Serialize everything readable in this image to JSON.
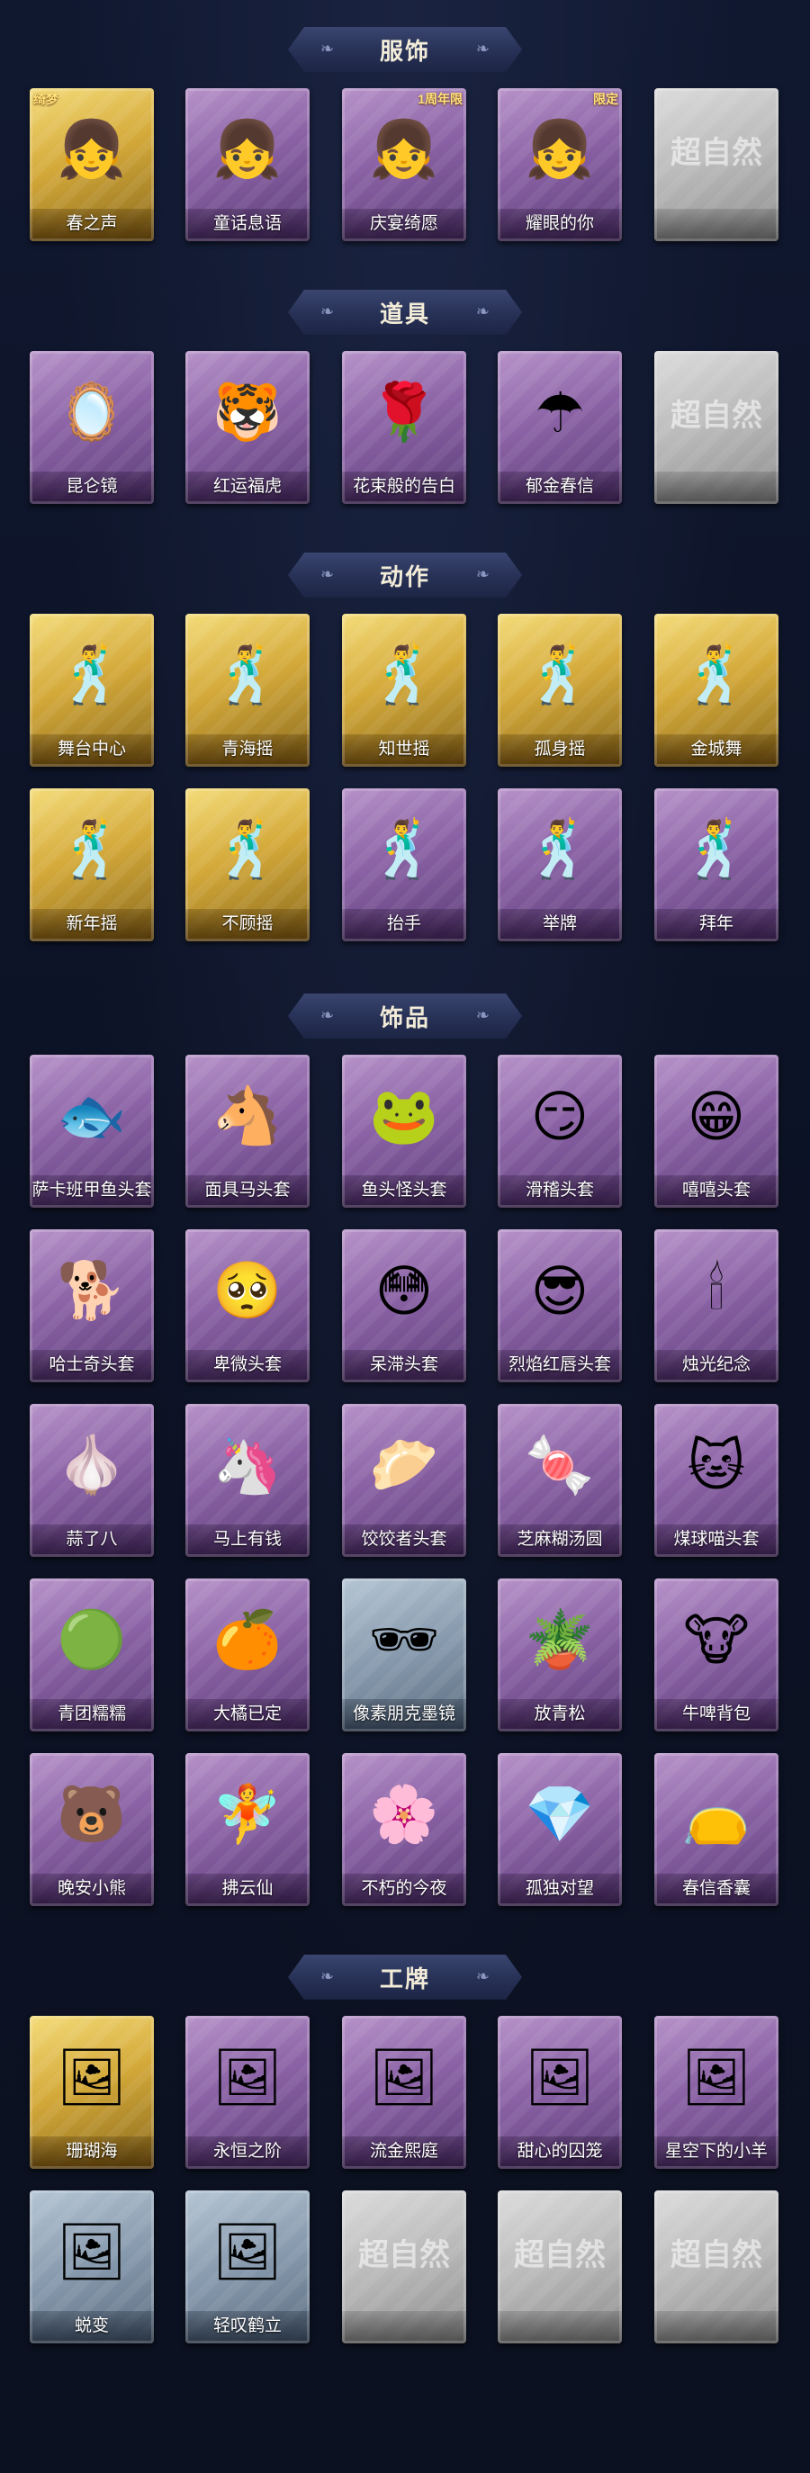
{
  "sections": {
    "clothing": {
      "title": "服饰",
      "items": [
        {
          "label": "春之声",
          "tier": "gold",
          "icon": "doll-portrait-icon",
          "badge": "绮梦"
        },
        {
          "label": "童话息语",
          "tier": "purple",
          "icon": "doll-portrait-icon",
          "badge": ""
        },
        {
          "label": "庆宴绮愿",
          "tier": "purple",
          "icon": "doll-portrait-icon",
          "badge": "1周年限"
        },
        {
          "label": "耀眼的你",
          "tier": "purple",
          "icon": "doll-portrait-icon",
          "badge": "限定"
        },
        {
          "label": "",
          "tier": "silver",
          "icon": "placeholder-logo-icon",
          "badge": "超自然"
        }
      ]
    },
    "props": {
      "title": "道具",
      "items": [
        {
          "label": "昆仑镜",
          "tier": "purple",
          "icon": "mirror-icon"
        },
        {
          "label": "红运福虎",
          "tier": "purple",
          "icon": "tiger-icon"
        },
        {
          "label": "花束般的告白",
          "tier": "purple",
          "icon": "rose-icon"
        },
        {
          "label": "郁金春信",
          "tier": "purple",
          "icon": "umbrella-icon"
        },
        {
          "label": "",
          "tier": "silver",
          "icon": "placeholder-logo-icon",
          "badge": "超自然"
        }
      ]
    },
    "actions": {
      "title": "动作",
      "items": [
        {
          "label": "舞台中心",
          "tier": "gold",
          "icon": "pose-icon"
        },
        {
          "label": "青海摇",
          "tier": "gold",
          "icon": "pose-icon"
        },
        {
          "label": "知世摇",
          "tier": "gold",
          "icon": "pose-icon"
        },
        {
          "label": "孤身摇",
          "tier": "gold",
          "icon": "pose-icon"
        },
        {
          "label": "金城舞",
          "tier": "gold",
          "icon": "pose-icon"
        },
        {
          "label": "新年摇",
          "tier": "gold",
          "icon": "pose-icon"
        },
        {
          "label": "不顾摇",
          "tier": "gold",
          "icon": "pose-icon"
        },
        {
          "label": "抬手",
          "tier": "purple",
          "icon": "pose-icon"
        },
        {
          "label": "举牌",
          "tier": "purple",
          "icon": "pose-icon"
        },
        {
          "label": "拜年",
          "tier": "purple",
          "icon": "pose-icon"
        }
      ]
    },
    "accessories": {
      "title": "饰品",
      "items": [
        {
          "label": "萨卡班甲鱼头套",
          "tier": "purple",
          "icon": "fish-head-icon"
        },
        {
          "label": "面具马头套",
          "tier": "purple",
          "icon": "horse-head-icon"
        },
        {
          "label": "鱼头怪头套",
          "tier": "purple",
          "icon": "frog-head-icon"
        },
        {
          "label": "滑稽头套",
          "tier": "purple",
          "icon": "smiley-icon"
        },
        {
          "label": "嘻嘻头套",
          "tier": "purple",
          "icon": "grin-icon"
        },
        {
          "label": "哈士奇头套",
          "tier": "purple",
          "icon": "dog-head-icon"
        },
        {
          "label": "卑微头套",
          "tier": "purple",
          "icon": "sad-face-icon"
        },
        {
          "label": "呆滞头套",
          "tier": "purple",
          "icon": "stare-face-icon"
        },
        {
          "label": "烈焰红唇头套",
          "tier": "purple",
          "icon": "pikachu-icon"
        },
        {
          "label": "烛光纪念",
          "tier": "purple",
          "icon": "candle-icon"
        },
        {
          "label": "蒜了八",
          "tier": "purple",
          "icon": "garlic-icon"
        },
        {
          "label": "马上有钱",
          "tier": "purple",
          "icon": "pony-icon"
        },
        {
          "label": "饺饺者头套",
          "tier": "purple",
          "icon": "dumpling-icon"
        },
        {
          "label": "芝麻糊汤圆",
          "tier": "purple",
          "icon": "rice-ball-icon"
        },
        {
          "label": "煤球喵头套",
          "tier": "purple",
          "icon": "cat-head-icon"
        },
        {
          "label": "青团糯糯",
          "tier": "purple",
          "icon": "green-ball-icon"
        },
        {
          "label": "大橘已定",
          "tier": "purple",
          "icon": "orange-icon"
        },
        {
          "label": "像素朋克墨镜",
          "tier": "blue",
          "icon": "pixel-sunglasses-icon"
        },
        {
          "label": "放青松",
          "tier": "purple",
          "icon": "bonsai-icon"
        },
        {
          "label": "牛啤背包",
          "tier": "purple",
          "icon": "cow-backpack-icon"
        },
        {
          "label": "晚安小熊",
          "tier": "purple",
          "icon": "bear-charm-icon"
        },
        {
          "label": "拂云仙",
          "tier": "purple",
          "icon": "fairy-charm-icon"
        },
        {
          "label": "不朽的今夜",
          "tier": "purple",
          "icon": "pink-charm-icon"
        },
        {
          "label": "孤独对望",
          "tier": "purple",
          "icon": "blue-charm-icon"
        },
        {
          "label": "春信香囊",
          "tier": "purple",
          "icon": "sachet-icon"
        }
      ]
    },
    "badges": {
      "title": "工牌",
      "items": [
        {
          "label": "珊瑚海",
          "tier": "gold",
          "icon": "card-frame-icon"
        },
        {
          "label": "永恒之阶",
          "tier": "purple",
          "icon": "card-frame-icon"
        },
        {
          "label": "流金熙庭",
          "tier": "purple",
          "icon": "card-frame-icon"
        },
        {
          "label": "甜心的囚笼",
          "tier": "purple",
          "icon": "card-frame-icon"
        },
        {
          "label": "星空下的小羊",
          "tier": "purple",
          "icon": "card-frame-icon"
        },
        {
          "label": "蜕变",
          "tier": "blue",
          "icon": "card-frame-icon"
        },
        {
          "label": "轻叹鹤立",
          "tier": "blue",
          "icon": "card-frame-icon"
        },
        {
          "label": "",
          "tier": "silver",
          "icon": "placeholder-logo-icon",
          "badge": "超自然"
        },
        {
          "label": "",
          "tier": "silver",
          "icon": "placeholder-logo-icon",
          "badge": "超自然"
        },
        {
          "label": "",
          "tier": "silver",
          "icon": "placeholder-logo-icon",
          "badge": "超自然"
        }
      ]
    }
  },
  "colors": {
    "background": "#0b1120",
    "banner": "#273156",
    "purple_tier": "#8a62a5",
    "gold_tier": "#d4a93a",
    "silver_tier": "#b8b8b8",
    "blue_tier": "#8699ad"
  }
}
